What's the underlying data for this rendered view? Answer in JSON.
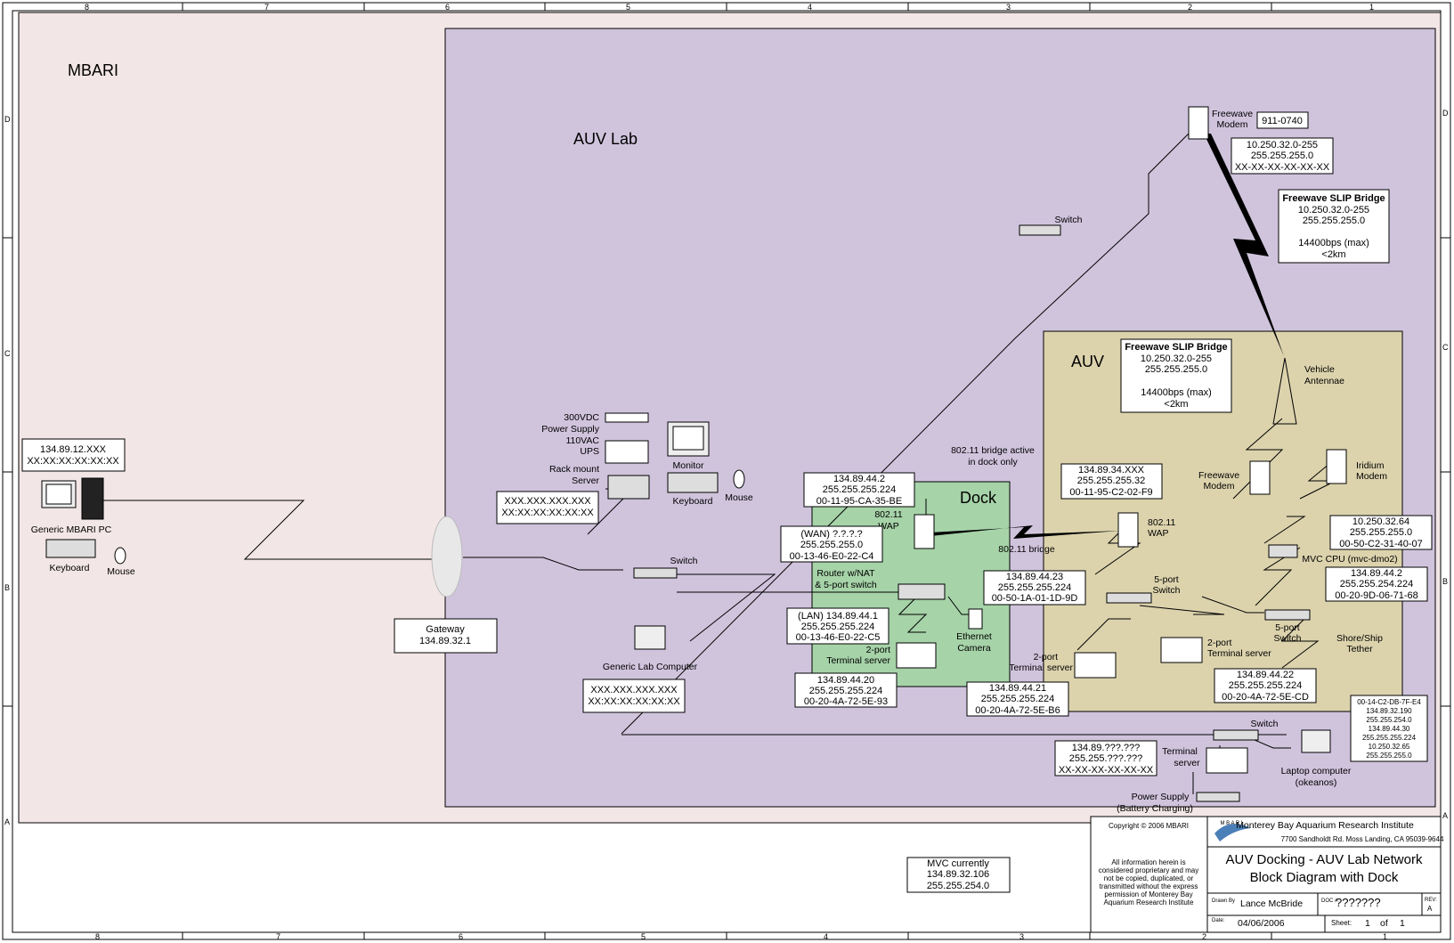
{
  "border": {
    "cols_top": [
      "8",
      "7",
      "6",
      "5",
      "4",
      "3",
      "2",
      "1"
    ],
    "cols_bottom": [
      "8",
      "7",
      "6",
      "5",
      "4",
      "3",
      "2",
      "1"
    ],
    "rows": [
      "D",
      "C",
      "B",
      "A"
    ]
  },
  "regions": {
    "mbari": "MBARI",
    "auv_lab": "AUV Lab",
    "auv": "AUV",
    "dock": "Dock"
  },
  "mbari_pc": {
    "box": [
      "134.89.12.XXX",
      "XX:XX:XX:XX:XX:XX"
    ],
    "pc_label": "Generic MBARI PC",
    "keyboard_label": "Keyboard",
    "mouse_label": "Mouse"
  },
  "gateway": {
    "lines": [
      "Gateway",
      "134.89.32.1"
    ]
  },
  "lab": {
    "psu_label": [
      "300VDC",
      "Power Supply"
    ],
    "ups_label": [
      "110VAC",
      "UPS"
    ],
    "server_label": [
      "Rack mount",
      "Server"
    ],
    "server_box": [
      "XXX.XXX.XXX.XXX",
      "XX:XX:XX:XX:XX:XX"
    ],
    "monitor_label": "Monitor",
    "keyboard_label": "Keyboard",
    "mouse_label": "Mouse",
    "switch_label": "Switch",
    "lab_pc_label": "Generic Lab Computer",
    "lab_pc_box": [
      "XXX.XXX.XXX.XXX",
      "XX:XX:XX:XX:XX:XX"
    ],
    "top_switch_label": "Switch"
  },
  "shore_modem": {
    "label": [
      "Freewave",
      "Modem"
    ],
    "id_box": "911-0740",
    "box": [
      "10.250.32.0-255",
      "255.255.255.0",
      "XX-XX-XX-XX-XX-XX"
    ],
    "bridge_box": [
      "Freewave SLIP Bridge",
      "10.250.32.0-255",
      "255.255.255.0",
      "",
      "14400bps (max)",
      "<2km"
    ]
  },
  "dock": {
    "wap_box": [
      "134.89.44.2",
      "255.255.255.224",
      "00-11-95-CA-35-BE"
    ],
    "wap_label": [
      "802.11",
      "WAP"
    ],
    "bridge_note": [
      "802.11 bridge active",
      "in dock only"
    ],
    "bridge_label": "802.11 bridge",
    "wan_box": [
      "(WAN) ?.?.?.?",
      "255.255.255.0",
      "00-13-46-E0-22-C4"
    ],
    "router_label": [
      "Router w/NAT",
      "& 5-port switch"
    ],
    "lan_box": [
      "(LAN) 134.89.44.1",
      "255.255.255.224",
      "00-13-46-E0-22-C5"
    ],
    "term_label": [
      "2-port",
      "Terminal server"
    ],
    "term_box": [
      "134.89.44.20",
      "255.255.255.224",
      "00-20-4A-72-5E-93"
    ],
    "camera_label": [
      "Ethernet",
      "Camera"
    ],
    "camera_box": [
      "134.89.44.23",
      "255.255.255.224",
      "00-50-1A-01-1D-9D"
    ],
    "term2_box": [
      "134.89.44.21",
      "255.255.255.224",
      "00-20-4A-72-5E-B6"
    ]
  },
  "auv": {
    "bridge_box": [
      "Freewave SLIP Bridge",
      "10.250.32.0-255",
      "255.255.255.0",
      "",
      "14400bps (max)",
      "<2km"
    ],
    "antenna_label": [
      "Vehicle",
      "Antennae"
    ],
    "wap_box": [
      "134.89.34.XXX",
      "255.255.255.32",
      "00-11-95-C2-02-F9"
    ],
    "wap_label": [
      "802.11",
      "WAP"
    ],
    "freewave_label": [
      "Freewave",
      "Modem"
    ],
    "iridium_label": [
      "Iridium",
      "Modem"
    ],
    "iridium_box": [
      "10.250.32.64",
      "255.255.255.0",
      "00-50-C2-31-40-07"
    ],
    "cpu_label": "MVC CPU (mvc-dmo2)",
    "cpu_box": [
      "134.89.44.2",
      "255.255.254.224",
      "00-20-9D-06-71-68"
    ],
    "switch_label": [
      "5-port",
      "Switch"
    ],
    "switch2_label": [
      "5-port",
      "Switch"
    ],
    "term_label": [
      "2-port",
      "Terminal server"
    ],
    "term2_label": [
      "2-port",
      "Terminal server"
    ],
    "tether_label": [
      "Shore/Ship",
      "Tether"
    ],
    "term_box": [
      "134.89.44.22",
      "255.255.255.224",
      "00-20-4A-72-5E-CD"
    ]
  },
  "shore": {
    "side_box": [
      "00-14-C2-DB-7F-E4",
      "134.89.32.190",
      "255.255.254.0",
      "134.89.44.30",
      "255.255.255.224",
      "10.250.32.65",
      "255.255.255.0"
    ],
    "switch_label": "Switch",
    "laptop_label": [
      "Laptop computer",
      "(okeanos)"
    ],
    "term_label": [
      "Terminal",
      "server"
    ],
    "term_box": [
      "134.89.???.???",
      "255.255.???.???",
      "XX-XX-XX-XX-XX-XX"
    ],
    "psu_label": [
      "Power Supply",
      "(Battery Charging)"
    ]
  },
  "mvc_note": [
    "MVC currently",
    "134.89.32.106",
    "255.255.254.0"
  ],
  "title_block": {
    "copyright": "Copyright © 2006 MBARI",
    "disclaimer": [
      "All information herein is",
      "considered proprietary and may",
      "not be copied, duplicated, or",
      "transmitted without the express",
      "permission of Monterey Bay",
      "Aquarium Research Institute"
    ],
    "org": "Monterey Bay Aquarium Research Institute",
    "logo_text": "M B A R I",
    "address": "7700 Sandholdt Rd.    Moss Landing, CA 95039-9644",
    "title": [
      "AUV Docking - AUV Lab Network",
      "Block Diagram with Dock"
    ],
    "drawn_by_label": "Drawn By",
    "drawn_by": "Lance McBride",
    "doc_label": "DOC #:",
    "doc": "???????",
    "rev_label": "REV:",
    "rev": "A",
    "date_label": "Date:",
    "date": "04/06/2006",
    "sheet_label": "Sheet:",
    "sheet": "1",
    "of_label": "of",
    "sheet_total": "1"
  },
  "colors": {
    "mbari_bg": "#f3e6e6",
    "lab_bg": "#d0c4dd",
    "auv_bg": "#dcd3ad",
    "dock_bg": "#a6d3a8"
  }
}
